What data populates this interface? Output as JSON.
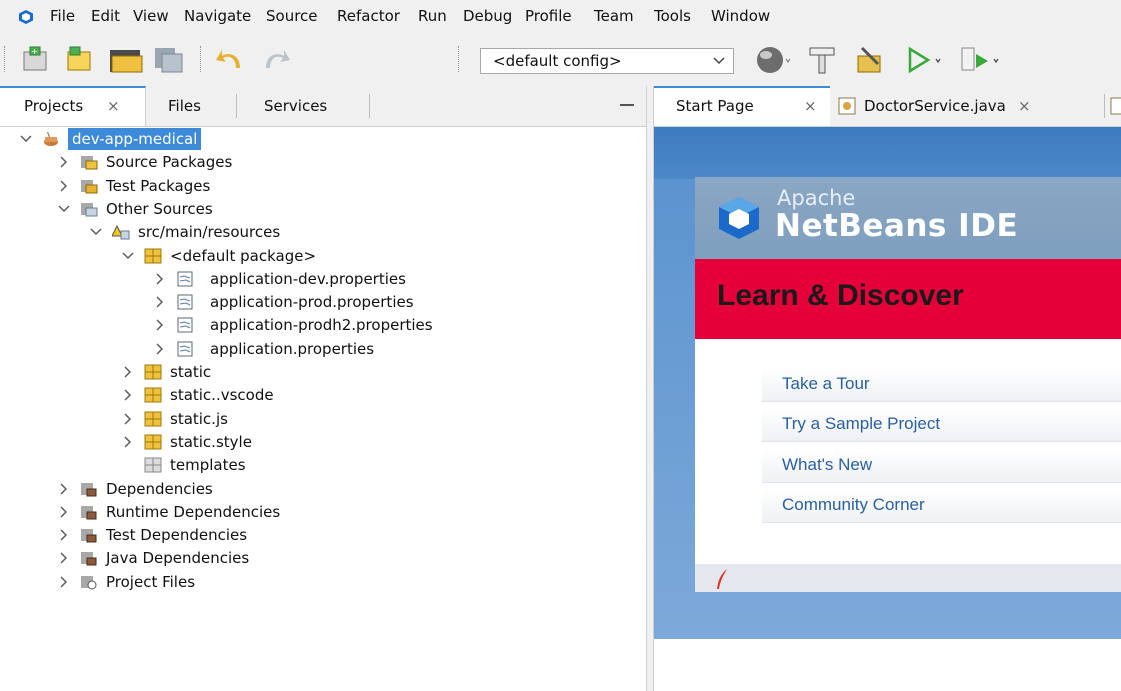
{
  "menu": [
    "File",
    "Edit",
    "View",
    "Navigate",
    "Source",
    "Refactor",
    "Run",
    "Debug",
    "Profile",
    "Team",
    "Tools",
    "Window"
  ],
  "toolbar": {
    "config_value": "<default config>"
  },
  "left_tabs": [
    {
      "label": "Projects",
      "close": "×"
    },
    {
      "label": "Files"
    },
    {
      "label": "Services"
    }
  ],
  "tree": [
    {
      "label": "dev-app-medical",
      "level": 0,
      "expander": "expanded",
      "icon": "project-coffee-icon",
      "selected": true
    },
    {
      "label": "Source Packages",
      "level": 1,
      "expander": "collapsed",
      "icon": "source-packages-icon"
    },
    {
      "label": "Test Packages",
      "level": 1,
      "expander": "collapsed",
      "icon": "test-packages-icon"
    },
    {
      "label": "Other Sources",
      "level": 1,
      "expander": "expanded",
      "icon": "other-sources-icon"
    },
    {
      "label": "src/main/resources",
      "level": 2,
      "expander": "expanded",
      "icon": "resources-folder-icon"
    },
    {
      "label": "<default package>",
      "level": 3,
      "expander": "expanded",
      "icon": "package-icon"
    },
    {
      "label": "application-dev.properties",
      "level": 4,
      "expander": "collapsed",
      "icon": "properties-file-icon"
    },
    {
      "label": "application-prod.properties",
      "level": 4,
      "expander": "collapsed",
      "icon": "properties-file-icon"
    },
    {
      "label": "application-prodh2.properties",
      "level": 4,
      "expander": "collapsed",
      "icon": "properties-file-icon"
    },
    {
      "label": "application.properties",
      "level": 4,
      "expander": "collapsed",
      "icon": "properties-file-icon"
    },
    {
      "label": "static",
      "level": 3,
      "expander": "collapsed",
      "icon": "package-icon"
    },
    {
      "label": "static..vscode",
      "level": 3,
      "expander": "collapsed",
      "icon": "package-icon"
    },
    {
      "label": "static.js",
      "level": 3,
      "expander": "collapsed",
      "icon": "package-icon"
    },
    {
      "label": "static.style",
      "level": 3,
      "expander": "collapsed",
      "icon": "package-icon"
    },
    {
      "label": "templates",
      "level": 3,
      "expander": "none",
      "icon": "empty-package-icon"
    },
    {
      "label": "Dependencies",
      "level": 1,
      "expander": "collapsed",
      "icon": "dependencies-icon"
    },
    {
      "label": "Runtime Dependencies",
      "level": 1,
      "expander": "collapsed",
      "icon": "dependencies-icon"
    },
    {
      "label": "Test Dependencies",
      "level": 1,
      "expander": "collapsed",
      "icon": "dependencies-icon"
    },
    {
      "label": "Java Dependencies",
      "level": 1,
      "expander": "collapsed",
      "icon": "dependencies-icon"
    },
    {
      "label": "Project Files",
      "level": 1,
      "expander": "collapsed",
      "icon": "project-files-icon"
    }
  ],
  "editor_tabs": [
    {
      "label": "Start Page",
      "close": "×"
    },
    {
      "label": "DoctorService.java",
      "close": "×"
    }
  ],
  "start_page": {
    "brand_top": "Apache",
    "brand_main": "NetBeans IDE",
    "heading": "Learn & Discover",
    "links": [
      "Take a Tour",
      "Try a Sample Project",
      "What's New",
      "Community Corner"
    ]
  },
  "colors": {
    "selection": "#3d8ad8",
    "learn_band": "#e6003a",
    "link": "#2a5f9e"
  }
}
